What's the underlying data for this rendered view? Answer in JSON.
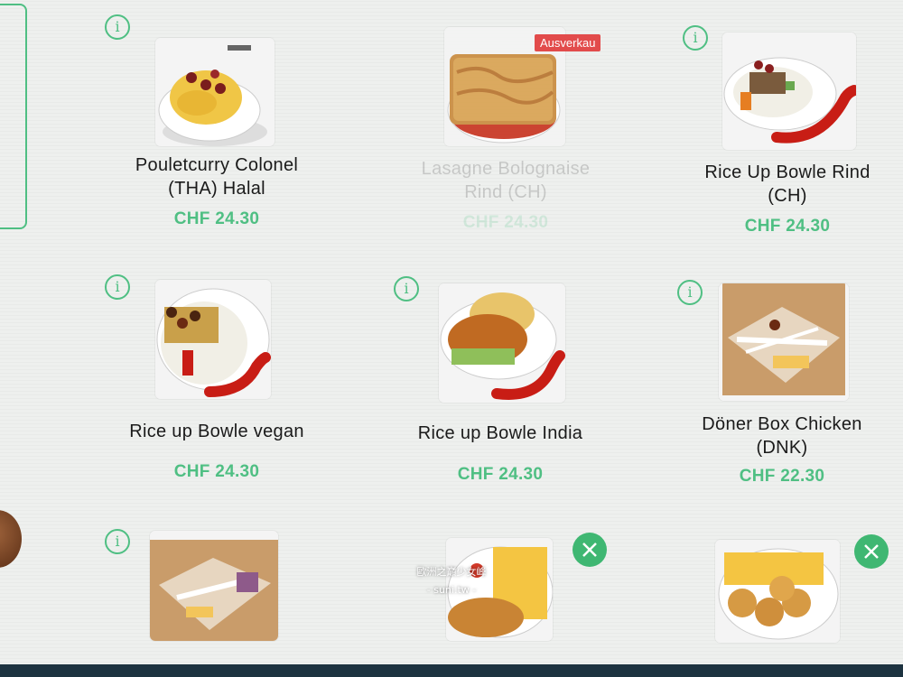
{
  "menu": {
    "items": [
      {
        "name_line1": "Pouletcurry Colonel",
        "name_line2": "(THA) Halal",
        "price": "CHF 24.30",
        "info_glyph": "i"
      },
      {
        "name_line1": "Lasagne Bolognaise",
        "name_line2": "Rind (CH)",
        "price": "CHF 24.30",
        "badge": "Ausverkau"
      },
      {
        "name_line1": "Rice Up Bowle Rind",
        "name_line2": "(CH)",
        "price": "CHF 24.30",
        "info_glyph": "i"
      },
      {
        "name_line1": "Rice up Bowle vegan",
        "name_line2": "",
        "price": "CHF 24.30",
        "info_glyph": "i"
      },
      {
        "name_line1": "Rice up Bowle India",
        "name_line2": "",
        "price": "CHF 24.30",
        "info_glyph": "i"
      },
      {
        "name_line1": "Döner Box Chicken",
        "name_line2": "(DNK)",
        "price": "CHF 22.30",
        "info_glyph": "i"
      },
      {
        "info_glyph": "i"
      },
      {
        "icon": "fork-knife-icon"
      },
      {
        "icon": "fork-knife-icon"
      }
    ]
  },
  "watermark": {
    "line1": "歐洲之巔少女峰",
    "line2": "- suni.tw -"
  },
  "colors": {
    "accent": "#4fbf83",
    "badge": "#e24b4b",
    "price": "#4fbf83"
  }
}
